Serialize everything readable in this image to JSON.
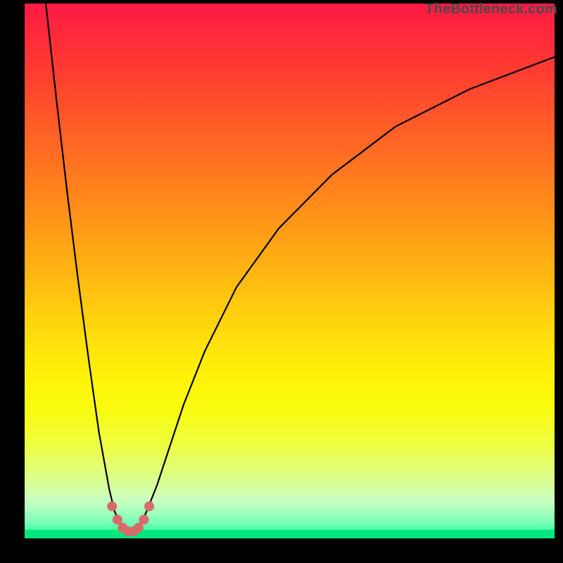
{
  "watermark": "TheBottleneck.com",
  "chart_data": {
    "type": "line",
    "title": "",
    "xlabel": "",
    "ylabel": "",
    "xlim": [
      0,
      100
    ],
    "ylim": [
      0,
      100
    ],
    "grid": false,
    "legend": false,
    "series": [
      {
        "name": "left-descent",
        "x": [
          4,
          6,
          8,
          10,
          12,
          14,
          16,
          17,
          18,
          19
        ],
        "y": [
          100,
          82,
          65,
          49,
          34,
          20,
          9,
          5,
          3,
          2
        ]
      },
      {
        "name": "right-ascent",
        "x": [
          21,
          22,
          23,
          25,
          27,
          30,
          34,
          40,
          48,
          58,
          70,
          84,
          100
        ],
        "y": [
          2,
          3,
          5,
          10,
          16,
          25,
          35,
          47,
          58,
          68,
          77,
          84,
          90
        ]
      },
      {
        "name": "valley-highlight",
        "x": [
          16.5,
          17.5,
          18.5,
          19.5,
          20.5,
          21.5,
          22.5,
          23.5
        ],
        "y": [
          6,
          3.5,
          2,
          1.3,
          1.3,
          2,
          3.5,
          6
        ]
      }
    ],
    "colors": {
      "curve": "#000000",
      "highlight": "#d96a6a",
      "gradient_top": "#ff1a45",
      "gradient_bottom": "#00ff88"
    }
  }
}
